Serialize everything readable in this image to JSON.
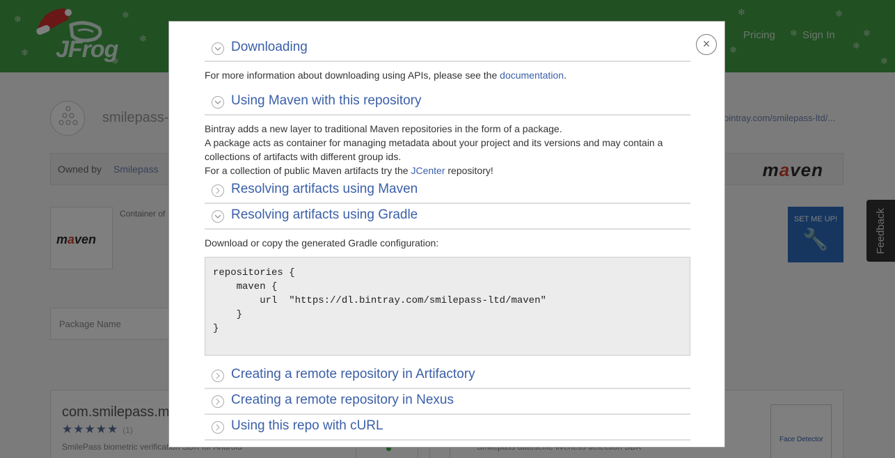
{
  "header": {
    "logo_text": "JFrog",
    "nav": {
      "pricing": "Pricing",
      "sign_in": "Sign In"
    }
  },
  "repo": {
    "title": "smilepass-",
    "url": "bintray.com/smilepass-ltd/...",
    "owned_by_label": "Owned by",
    "owner": "Smilepass",
    "container_of": "Container of",
    "maven_logo": "maven",
    "set_me_up": "SET ME UP!",
    "package_name_label": "Package Name"
  },
  "package_card": {
    "name": "com.smilepass.m",
    "rating_count": "(1)",
    "rating": 5,
    "description": "SmilePass biometric verification SDK for Android",
    "description_right": "Smilepass autoselfie liveness detection SDK",
    "face_detector": "Face Detector"
  },
  "feedback": {
    "label": "Feedback"
  },
  "modal": {
    "close_glyph": "×",
    "sections": {
      "downloading": "Downloading",
      "maven_repo": "Using Maven with this repository",
      "resolve_maven": "Resolving artifacts using Maven",
      "resolve_gradle": "Resolving artifacts using Gradle",
      "artifactory": "Creating a remote repository in Artifactory",
      "nexus": "Creating a remote repository in Nexus",
      "curl": "Using this repo with cURL"
    },
    "downloading_text": {
      "before": "For more information about downloading using APIs, please see the ",
      "link": "documentation",
      "after": "."
    },
    "maven_text": {
      "line1": "Bintray adds a new layer to traditional Maven repositories in the form of a package.",
      "line2": "A package acts as container for managing metadata about your project and its versions and may contain a collections of artifacts with different group ids.",
      "line3_before": "For a collection of public Maven artifacts try the ",
      "line3_link": "JCenter",
      "line3_after": " repository!"
    },
    "gradle_text": "Download or copy the generated Gradle configuration:",
    "gradle_code": "repositories {\n    maven {\n        url  \"https://dl.bintray.com/smilepass-ltd/maven\"\n    }\n}"
  }
}
